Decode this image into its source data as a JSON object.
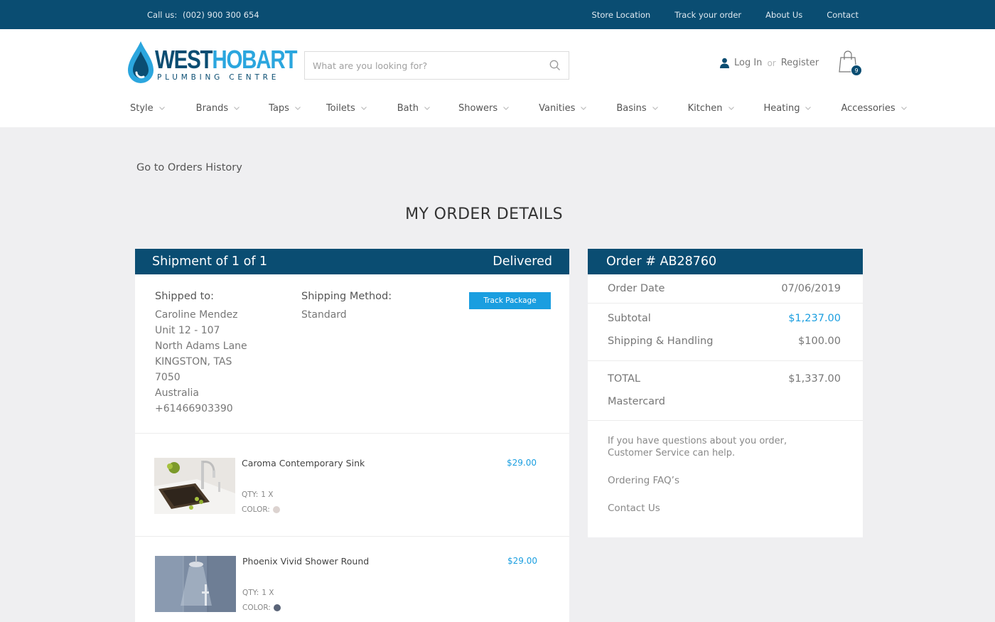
{
  "topbar": {
    "call_label": "Call us:",
    "phone": "(002) 900 300 654",
    "links": [
      "Store Location",
      "Track your order",
      "About Us",
      "Contact"
    ]
  },
  "logo": {
    "word_part1": "WEST",
    "word_part2": "HOBART",
    "subtitle": "PLUMBING CENTRE"
  },
  "search": {
    "placeholder": "What are you looking for?"
  },
  "account": {
    "login": "Log In",
    "or": "or",
    "register": "Register"
  },
  "cart": {
    "count": "9"
  },
  "nav": {
    "items": [
      "Style",
      "Brands",
      "Taps",
      "Toilets",
      "Bath",
      "Showers",
      "Vanities",
      "Basins",
      "Kitchen",
      "Heating",
      "Accessories"
    ]
  },
  "main": {
    "back_link": "Go to Orders History",
    "title": "MY ORDER DETAILS"
  },
  "shipment": {
    "title": "Shipment of 1 of 1",
    "status": "Delivered",
    "shipped_to_label": "Shipped to:",
    "address": [
      "Caroline Mendez",
      "Unit 12 - 107",
      "North Adams Lane",
      "KINGSTON, TAS",
      "7050",
      "Australia",
      "+61466903390"
    ],
    "method_label": "Shipping Method:",
    "method": "Standard",
    "track_button": "Track Package",
    "items": [
      {
        "name": "Caroma Contemporary Sink",
        "price": "$29.00",
        "qty_label": "QTY:",
        "qty": "1 X",
        "color_label": "COLOR:",
        "color": "#dcd3d0"
      },
      {
        "name": "Phoenix Vivid Shower Round",
        "price": "$29.00",
        "qty_label": "QTY:",
        "qty": "1 X",
        "color_label": "COLOR:",
        "color": "#5a6478"
      }
    ]
  },
  "order": {
    "title": "Order # AB28760",
    "date_label": "Order Date",
    "date": "07/06/2019",
    "subtotal_label": "Subtotal",
    "subtotal": "$1,237.00",
    "shipping_label": "Shipping & Handling",
    "shipping": "$100.00",
    "total_label": "TOTAL",
    "total": "$1,337.00",
    "payment": "Mastercard",
    "help_line1": "If you have questions about you order,",
    "help_line2": "Customer Service can help.",
    "faq_link": "Ordering FAQ’s",
    "contact_link": "Contact Us"
  },
  "colors": {
    "primary": "#0a4d72",
    "accent": "#1a9ee0",
    "logo_light": "#2ba6de"
  },
  "icons": {
    "search": "search-icon",
    "user": "user-icon",
    "cart": "shopping-bag-icon",
    "chevron": "chevron-down-icon"
  }
}
